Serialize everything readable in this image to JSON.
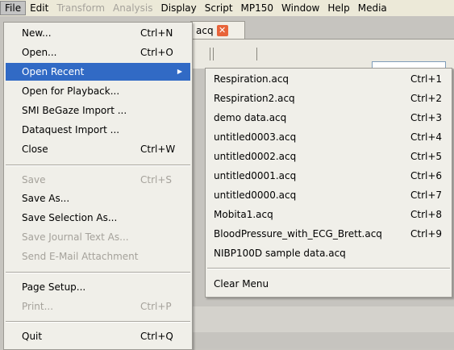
{
  "menubar": {
    "file": "File",
    "edit": "Edit",
    "transform": "Transform",
    "analysis": "Analysis",
    "display": "Display",
    "script": "Script",
    "mp150": "MP150",
    "window": "Window",
    "help": "Help",
    "media": "Media"
  },
  "document_tab": {
    "label": "acq"
  },
  "file_menu": {
    "items": [
      {
        "label": "New...",
        "shortcut": "Ctrl+N"
      },
      {
        "label": "Open...",
        "shortcut": "Ctrl+O"
      },
      {
        "label": "Open Recent",
        "shortcut": ""
      },
      {
        "label": "Open for Playback...",
        "shortcut": ""
      },
      {
        "label": "SMI BeGaze Import ...",
        "shortcut": ""
      },
      {
        "label": "Dataquest Import ...",
        "shortcut": ""
      },
      {
        "label": "Close",
        "shortcut": "Ctrl+W"
      },
      {
        "label": "Save",
        "shortcut": "Ctrl+S"
      },
      {
        "label": "Save As...",
        "shortcut": ""
      },
      {
        "label": "Save Selection As...",
        "shortcut": ""
      },
      {
        "label": "Save Journal Text As...",
        "shortcut": ""
      },
      {
        "label": "Send E-Mail Attachment",
        "shortcut": ""
      },
      {
        "label": "Page Setup...",
        "shortcut": ""
      },
      {
        "label": "Print...",
        "shortcut": "Ctrl+P"
      },
      {
        "label": "Quit",
        "shortcut": "Ctrl+Q"
      }
    ]
  },
  "recent_menu": {
    "items": [
      {
        "label": "Respiration.acq",
        "shortcut": "Ctrl+1"
      },
      {
        "label": "Respiration2.acq",
        "shortcut": "Ctrl+2"
      },
      {
        "label": "demo data.acq",
        "shortcut": "Ctrl+3"
      },
      {
        "label": "untitled0003.acq",
        "shortcut": "Ctrl+4"
      },
      {
        "label": "untitled0002.acq",
        "shortcut": "Ctrl+5"
      },
      {
        "label": "untitled0001.acq",
        "shortcut": "Ctrl+6"
      },
      {
        "label": "untitled0000.acq",
        "shortcut": "Ctrl+7"
      },
      {
        "label": "Mobita1.acq",
        "shortcut": "Ctrl+8"
      },
      {
        "label": "BloodPressure_with_ECG_Brett.acq",
        "shortcut": "Ctrl+9"
      },
      {
        "label": "NIBP100D sample data.acq",
        "shortcut": ""
      },
      {
        "label": "Clear Menu",
        "shortcut": ""
      }
    ]
  }
}
